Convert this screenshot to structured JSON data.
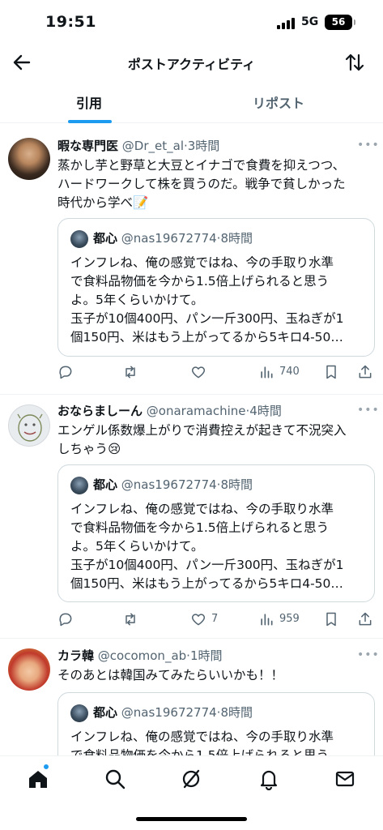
{
  "status": {
    "time": "19:51",
    "network": "5G",
    "battery": "56"
  },
  "header": {
    "title": "ポストアクティビティ"
  },
  "tabs": [
    {
      "label": "引用"
    },
    {
      "label": "リポスト"
    }
  ],
  "posts": [
    {
      "name": "暇な専門医",
      "handle": "@Dr_et_al",
      "time": "3時間",
      "text_lines": [
        "蒸かし芋と野草と大豆とイナゴで食費を抑えつつ、",
        "ハードワークして株を買うのだ。戦争で貧しかった",
        "時代から学べ📝"
      ],
      "quote": {
        "name": "都心",
        "handle": "@nas19672774",
        "time": "8時間",
        "lines": [
          "インフレね、俺の感覚ではね、今の手取り水準",
          "で食料品物価を今から1.5倍上げられると思う",
          "よ。5年くらいかけて。",
          "玉子が10個400円、パン一斤300円、玉ねぎが1",
          "個150円、米はもう上がってるから5キロ4-50…"
        ]
      },
      "actions": {
        "reply": "",
        "repost": "",
        "like": "",
        "views": "740"
      }
    },
    {
      "name": "おならましーん",
      "handle": "@onaramachine",
      "time": "4時間",
      "text_lines": [
        "エンゲル係数爆上がりで消費控えが起きて不況突入",
        "しちゃう😢"
      ],
      "quote": {
        "name": "都心",
        "handle": "@nas19672774",
        "time": "8時間",
        "lines": [
          "インフレね、俺の感覚ではね、今の手取り水準",
          "で食料品物価を今から1.5倍上げられると思う",
          "よ。5年くらいかけて。",
          "玉子が10個400円、パン一斤300円、玉ねぎが1",
          "個150円、米はもう上がってるから5キロ4-50…"
        ]
      },
      "actions": {
        "reply": "",
        "repost": "",
        "like": "7",
        "views": "959"
      }
    },
    {
      "name": "カラ韓",
      "handle": "@cocomon_ab",
      "time": "1時間",
      "text_lines": [
        "そのあとは韓国みてみたらいいかも！！"
      ],
      "quote": {
        "name": "都心",
        "handle": "@nas19672774",
        "time": "8時間",
        "lines": [
          "インフレね、俺の感覚ではね、今の手取り水準",
          "で食料品物価を今から1.5倍上げられると思う"
        ]
      }
    }
  ],
  "icons": {
    "back": "arrow-left-icon",
    "sort": "sort-arrows-icon",
    "home": "home-icon",
    "search": "search-icon",
    "grok": "grok-icon",
    "notifications": "bell-icon",
    "messages": "mail-icon"
  },
  "colors": {
    "accent": "#1d9bf0",
    "text": "#0f1419",
    "muted": "#536471",
    "border": "#cfd9de"
  }
}
